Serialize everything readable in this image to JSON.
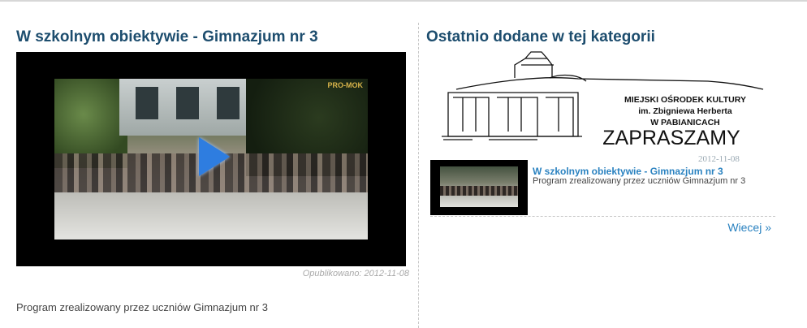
{
  "left": {
    "title": "W szkolnym obiektywie - Gimnazjum nr 3",
    "video": {
      "logo_text": "PRO-MOK",
      "play_icon": "play-icon"
    },
    "published": "Opublikowano: 2012-11-08",
    "description": "Program zrealizowany przez uczniów Gimnazjum nr 3"
  },
  "right": {
    "title": "Ostatnio dodane w tej kategorii",
    "banner": {
      "line1": "MIEJSKI OŚRODEK KULTURY",
      "line2": "im. Zbigniewa Herberta",
      "line3": "W PABIANICACH",
      "line4": "ZAPRASZAMY",
      "date": "2012-11-08"
    },
    "items": [
      {
        "title": "W szkolnym obiektywie - Gimnazjum nr 3",
        "description": "Program zrealizowany przez uczniów Gimnazjum nr 3"
      }
    ],
    "more_label": "Wiecej »"
  },
  "colors": {
    "heading": "#1d4d6e",
    "link": "#2a82c0",
    "play": "#2e7de0"
  }
}
